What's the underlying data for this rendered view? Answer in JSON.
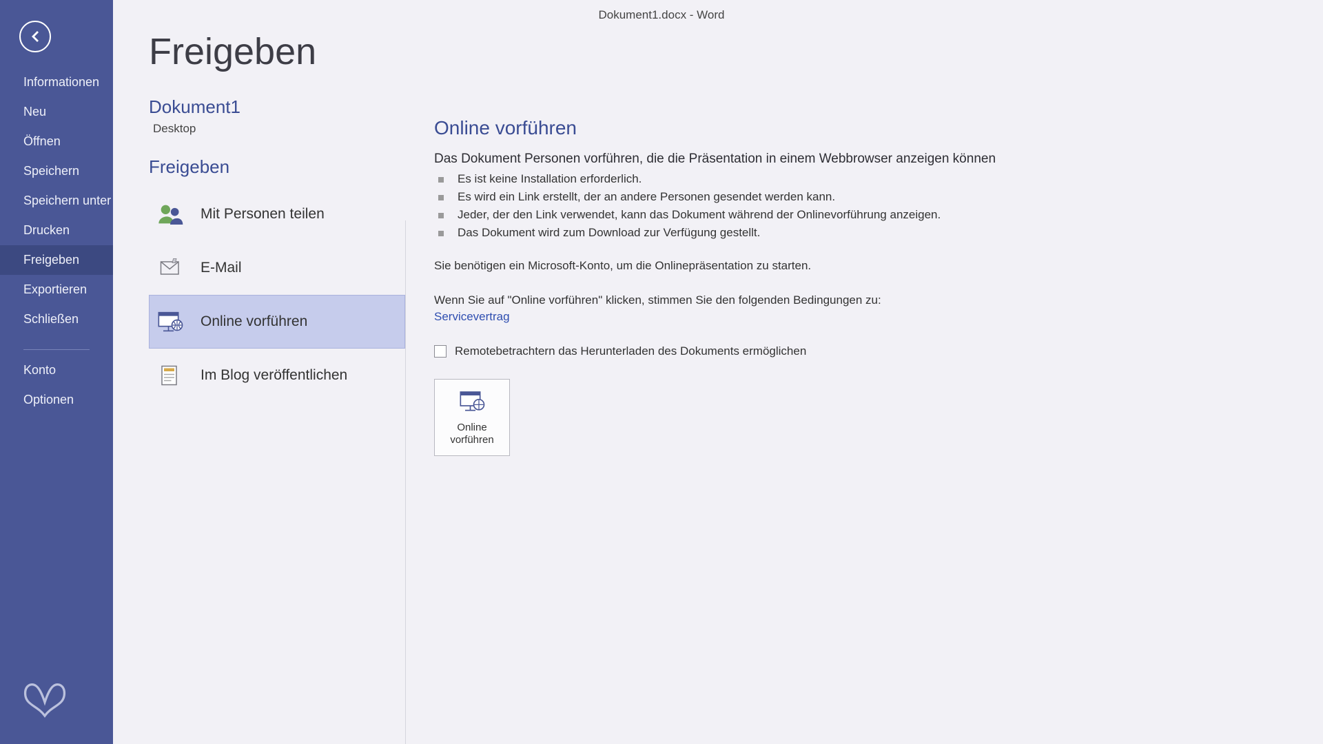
{
  "titlebar": "Dokument1.docx - Word",
  "page_heading": "Freigeben",
  "document": {
    "name": "Dokument1",
    "location": "Desktop"
  },
  "nav": {
    "info": "Informationen",
    "new": "Neu",
    "open": "Öffnen",
    "save": "Speichern",
    "saveas": "Speichern unter",
    "print": "Drucken",
    "share": "Freigeben",
    "export": "Exportieren",
    "close": "Schließen",
    "account": "Konto",
    "options": "Optionen"
  },
  "share": {
    "heading": "Freigeben",
    "options": {
      "people": "Mit Personen teilen",
      "email": "E-Mail",
      "present": "Online vorführen",
      "blog": "Im Blog veröffentlichen"
    }
  },
  "detail": {
    "heading": "Online vorführen",
    "lead": "Das Dokument Personen vorführen, die die Präsentation in einem Webbrowser anzeigen können",
    "bullets": [
      "Es ist keine Installation erforderlich.",
      "Es wird ein Link erstellt, der an andere Personen gesendet werden kann.",
      "Jeder, der den Link verwendet, kann das Dokument während der Onlinevorführung anzeigen.",
      "Das Dokument wird zum Download zur Verfügung gestellt."
    ],
    "need_account": "Sie benötigen ein Microsoft-Konto, um die Onlinepräsentation zu starten.",
    "agree": "Wenn Sie auf \"Online vorführen\" klicken, stimmen Sie den folgenden Bedingungen zu:",
    "link": "Servicevertrag",
    "checkbox": "Remotebetrachtern das Herunterladen des Dokuments ermöglichen",
    "button": "Online vorführen"
  }
}
